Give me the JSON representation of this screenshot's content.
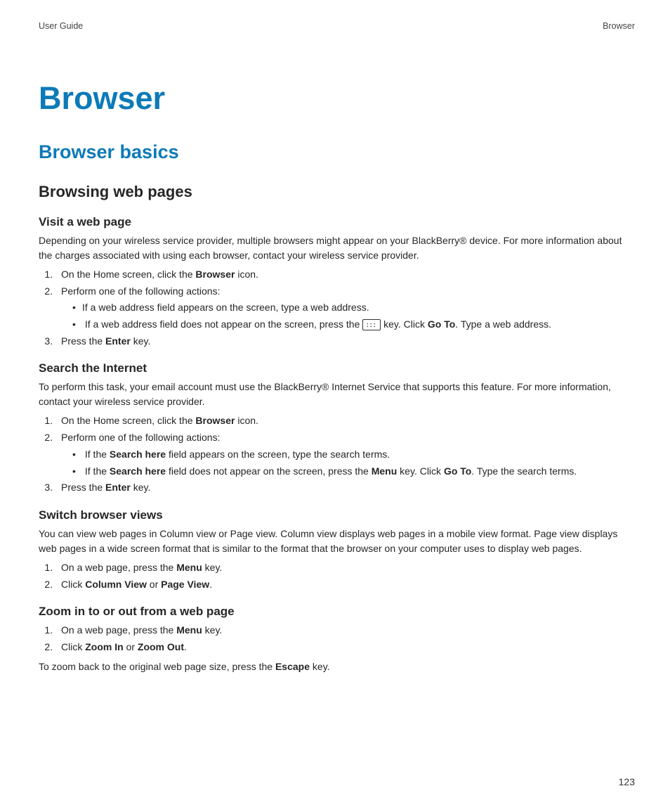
{
  "header": {
    "left": "User Guide",
    "right": "Browser"
  },
  "title": "Browser",
  "section": "Browser basics",
  "subsection": "Browsing web pages",
  "page_number": "123",
  "topics": {
    "visit": {
      "heading": "Visit a web page",
      "intro": "Depending on your wireless service provider, multiple browsers might appear on your BlackBerry® device. For more information about the charges associated with using each browser, contact your wireless service provider.",
      "step1_a": "On the Home screen, click the ",
      "step1_b": "Browser",
      "step1_c": " icon.",
      "step2": "Perform one of the following actions:",
      "sub1": "If a web address field appears on the screen, type a web address.",
      "sub2_a": "If a web address field does not appear on the screen, press the ",
      "sub2_b": " key. Click ",
      "sub2_c": "Go To",
      "sub2_d": ". Type a web address.",
      "step3_a": "Press the ",
      "step3_b": "Enter",
      "step3_c": " key."
    },
    "search": {
      "heading": "Search the Internet",
      "intro": "To perform this task, your email account must use the BlackBerry® Internet Service that supports this feature. For more information, contact your wireless service provider.",
      "step1_a": "On the Home screen, click the ",
      "step1_b": "Browser",
      "step1_c": " icon.",
      "step2": "Perform one of the following actions:",
      "sub1_a": "If the ",
      "sub1_b": "Search here",
      "sub1_c": " field appears on the screen, type the search terms.",
      "sub2_a": "If the ",
      "sub2_b": "Search here",
      "sub2_c": " field does not appear on the screen, press the ",
      "sub2_d": "Menu",
      "sub2_e": " key. Click ",
      "sub2_f": "Go To",
      "sub2_g": ". Type the search terms.",
      "step3_a": "Press the ",
      "step3_b": "Enter",
      "step3_c": " key."
    },
    "switch": {
      "heading": "Switch browser views",
      "intro": "You can view web pages in Column view or Page view. Column view displays web pages in a mobile view format. Page view displays web pages in a wide screen format that is similar to the format that the browser on your computer uses to display web pages.",
      "step1_a": "On a web page, press the ",
      "step1_b": "Menu",
      "step1_c": " key.",
      "step2_a": "Click ",
      "step2_b": "Column View",
      "step2_c": " or ",
      "step2_d": "Page View",
      "step2_e": "."
    },
    "zoom": {
      "heading": "Zoom in to or out from a web page",
      "step1_a": "On a web page, press the ",
      "step1_b": "Menu",
      "step1_c": " key.",
      "step2_a": "Click ",
      "step2_b": "Zoom In",
      "step2_c": " or ",
      "step2_d": "Zoom Out",
      "step2_e": ".",
      "outro_a": "To zoom back to the original web page size, press the ",
      "outro_b": "Escape",
      "outro_c": " key."
    }
  },
  "icons": {
    "menu_key_glyph": ":::"
  }
}
